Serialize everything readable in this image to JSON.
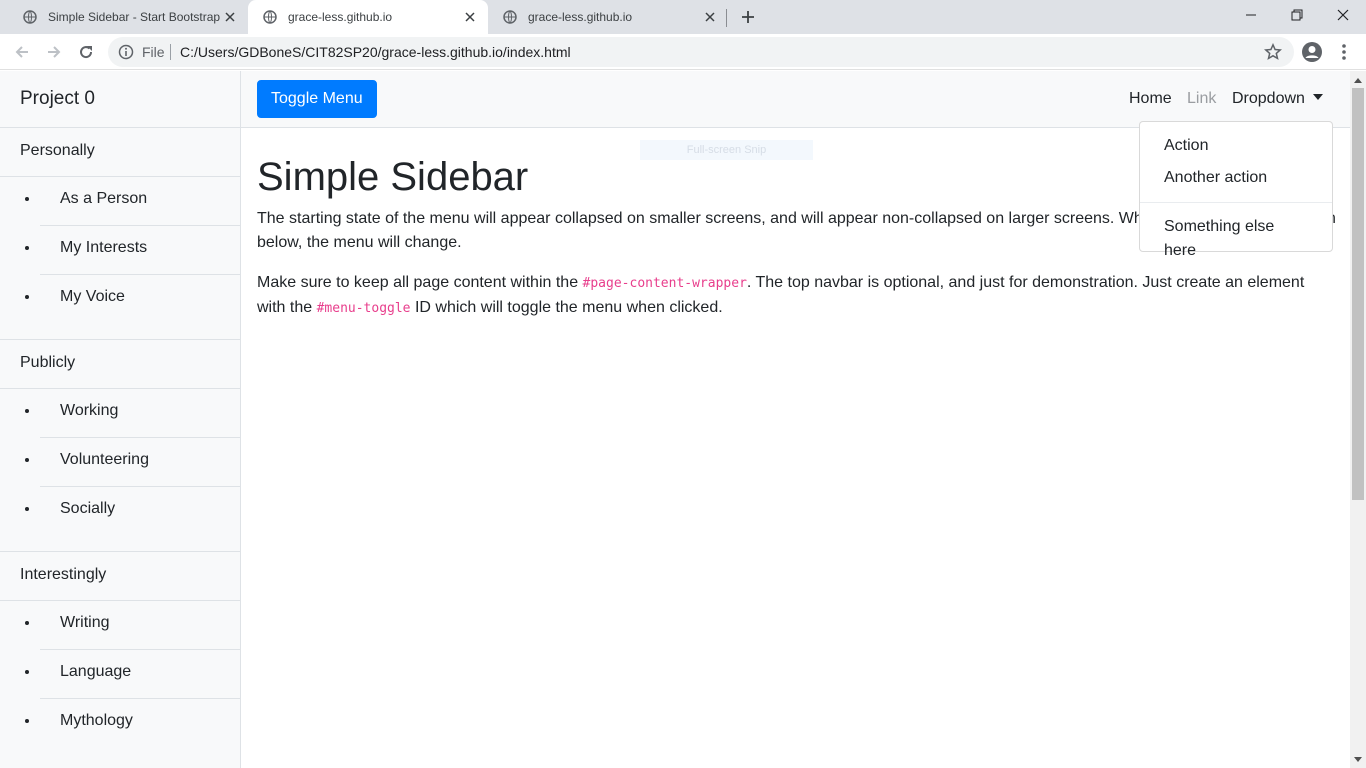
{
  "browser": {
    "tabs": [
      {
        "title": "Simple Sidebar - Start Bootstrap",
        "active": false
      },
      {
        "title": "grace-less.github.io",
        "active": true
      },
      {
        "title": "grace-less.github.io",
        "active": false
      }
    ],
    "address": {
      "scheme_label": "File",
      "url": "C:/Users/GDBoneS/CIT82SP20/grace-less.github.io/index.html"
    }
  },
  "sidebar": {
    "heading": "Project 0",
    "sections": [
      {
        "label": "Personally",
        "items": [
          "As a Person",
          "My Interests",
          "My Voice"
        ]
      },
      {
        "label": "Publicly",
        "items": [
          "Working",
          "Volunteering",
          "Socially"
        ]
      },
      {
        "label": "Interestingly",
        "items": [
          "Writing",
          "Language",
          "Mythology"
        ]
      }
    ]
  },
  "navbar": {
    "toggle_label": "Toggle Menu",
    "home": "Home",
    "link": "Link",
    "dropdown": "Dropdown",
    "dropdown_items": {
      "action": "Action",
      "another": "Another action",
      "else": "Something else here"
    }
  },
  "main": {
    "title": "Simple Sidebar",
    "p1": "The starting state of the menu will appear collapsed on smaller screens, and will appear non-collapsed on larger screens. When toggled using the button below, the menu will change.",
    "p2_a": "Make sure to keep all page content within the ",
    "p2_code1": "#page-content-wrapper",
    "p2_b": ". The top navbar is optional, and just for demonstration. Just create an element with the ",
    "p2_code2": "#menu-toggle",
    "p2_c": " ID which will toggle the menu when clicked."
  },
  "overlay": {
    "snip_label": "Full-screen Snip"
  },
  "colors": {
    "primary": "#007bff",
    "sidebar_bg": "#f8f9fa",
    "code": "#e83e8c"
  }
}
